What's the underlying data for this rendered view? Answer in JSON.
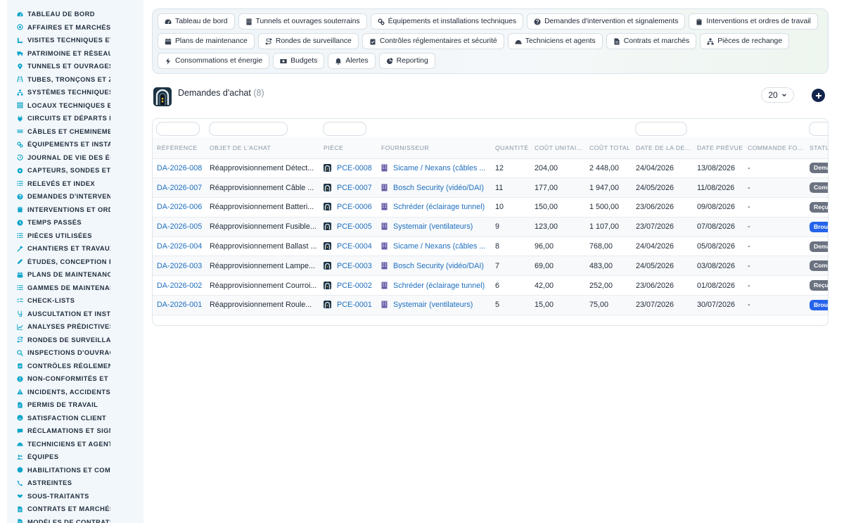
{
  "sidebar": {
    "items": [
      {
        "label": "TABLEAU DE BORD",
        "icon": "gauge-icon"
      },
      {
        "label": "AFFAIRES ET MARCHÉS",
        "icon": "target-icon"
      },
      {
        "label": "VISITES TECHNIQUES ET",
        "icon": "ruler-icon"
      },
      {
        "label": "PATRIMOINE ET RÉSEAUX",
        "icon": "truck-icon"
      },
      {
        "label": "TUNNELS ET OUVRAGES",
        "icon": "map-pin-icon"
      },
      {
        "label": "TUBES, TRONÇONS ET ZO",
        "icon": "road-icon"
      },
      {
        "label": "SYSTÈMES TECHNIQUES",
        "icon": "sitemap-icon"
      },
      {
        "label": "LOCAUX TECHNIQUES ET",
        "icon": "grid-icon"
      },
      {
        "label": "CIRCUITS ET DÉPARTS ÉL",
        "icon": "plug-icon"
      },
      {
        "label": "CÂBLES ET CHEMINEMENT",
        "icon": "cable-icon"
      },
      {
        "label": "ÉQUIPEMENTS ET INSTAL",
        "icon": "gears-icon"
      },
      {
        "label": "JOURNAL DE VIE DES ÉQ",
        "icon": "history-icon"
      },
      {
        "label": "CAPTEURS, SONDES ET C",
        "icon": "sensor-icon"
      },
      {
        "label": "RELEVÉS ET INDEX",
        "icon": "list-icon"
      },
      {
        "label": "DEMANDES D'INTERVENT",
        "icon": "question-icon"
      },
      {
        "label": "INTERVENTIONS ET ORDI",
        "icon": "clipboard-icon"
      },
      {
        "label": "TEMPS PASSÉS",
        "icon": "clock-icon"
      },
      {
        "label": "PIÈCES UTILISÉES",
        "icon": "list-icon"
      },
      {
        "label": "CHANTIERS ET TRAVAUX",
        "icon": "hammer-icon"
      },
      {
        "label": "ÉTUDES, CONCEPTION ET",
        "icon": "pen-ruler-icon"
      },
      {
        "label": "PLANS DE MAINTENANCE",
        "icon": "calendar-icon"
      },
      {
        "label": "GAMMES DE MAINTENAN",
        "icon": "list-icon"
      },
      {
        "label": "CHECK-LISTS",
        "icon": "checklist-icon"
      },
      {
        "label": "AUSCULTATION ET INSTR",
        "icon": "stethoscope-icon"
      },
      {
        "label": "ANALYSES PRÉDICTIVES",
        "icon": "chart-icon"
      },
      {
        "label": "RONDES DE SURVEILLAN",
        "icon": "route-icon"
      },
      {
        "label": "INSPECTIONS D'OUVRAG",
        "icon": "search-icon"
      },
      {
        "label": "CONTRÔLES RÉGLEMENT",
        "icon": "clipboard-check-icon"
      },
      {
        "label": "NON-CONFORMITÉS ET A",
        "icon": "alert-circle-icon"
      },
      {
        "label": "INCIDENTS, ACCIDENTS E",
        "icon": "warning-icon"
      },
      {
        "label": "PERMIS DE TRAVAIL",
        "icon": "file-pen-icon"
      },
      {
        "label": "SATISFACTION CLIENT",
        "icon": "smile-icon"
      },
      {
        "label": "RÉCLAMATIONS ET SIGNA",
        "icon": "comment-icon"
      },
      {
        "label": "TECHNICIENS ET AGENTS",
        "icon": "helmet-icon"
      },
      {
        "label": "ÉQUIPES",
        "icon": "users-icon"
      },
      {
        "label": "HABILITATIONS ET COMP",
        "icon": "certificate-icon"
      },
      {
        "label": "ASTREINTES",
        "icon": "phone-icon"
      },
      {
        "label": "SOUS-TRAITANTS",
        "icon": "handshake-icon"
      },
      {
        "label": "CONTRATS ET MARCHÉS",
        "icon": "file-icon"
      },
      {
        "label": "MODÈLES DE CONTRATS",
        "icon": "file-icon"
      }
    ]
  },
  "topnav": {
    "chips": [
      {
        "label": "Tableau de bord",
        "icon": "gauge-icon"
      },
      {
        "label": "Tunnels et ouvrages souterrains",
        "icon": "building-icon"
      },
      {
        "label": "Équipements et installations techniques",
        "icon": "gears-icon"
      },
      {
        "label": "Demandes d'intervention et signalements",
        "icon": "question-icon"
      },
      {
        "label": "Interventions et ordres de travail",
        "icon": "clipboard-icon"
      },
      {
        "label": "Plans de maintenance",
        "icon": "calendar-icon"
      },
      {
        "label": "Rondes de surveillance",
        "icon": "route-icon"
      },
      {
        "label": "Contrôles réglementaires et sécurité",
        "icon": "clipboard-check-icon"
      },
      {
        "label": "Techniciens et agents",
        "icon": "helmet-icon"
      },
      {
        "label": "Contrats et marchés",
        "icon": "file-icon"
      },
      {
        "label": "Pièces de rechange",
        "icon": "sitemap-icon"
      },
      {
        "label": "Consommations et énergie",
        "icon": "bolt-icon"
      },
      {
        "label": "Budgets",
        "icon": "money-icon"
      },
      {
        "label": "Alertes",
        "icon": "bell-icon"
      },
      {
        "label": "Reporting",
        "icon": "pie-icon"
      }
    ]
  },
  "page": {
    "title": "Demandes d'achat",
    "count": "(8)",
    "per_page": "20"
  },
  "table": {
    "columns": [
      "RÉFÉRENCE",
      "OBJET DE L'ACHAT",
      "PIÈCE",
      "FOURNISSEUR",
      "QUANTITÉ",
      "COÛT UNITAIRE",
      "COÛT TOTAL",
      "DATE DE LA DE...",
      "DATE PRÉVUE",
      "COMMANDE FO...",
      "STATUT"
    ],
    "rows": [
      {
        "ref": "DA-2026-008",
        "objet": "Réapprovisionnement Détect...",
        "piece": "PCE-0008",
        "fournisseur": "Sicame / Nexans (câbles ...",
        "qte": "12",
        "cu": "204,00",
        "ct": "2 448,00",
        "date_dem": "24/04/2026",
        "date_prev": "13/08/2026",
        "commande": "-",
        "statut": "Demande",
        "statut_color": "#6b7280"
      },
      {
        "ref": "DA-2026-007",
        "objet": "Réapprovisionnement Câble ...",
        "piece": "PCE-0007",
        "fournisseur": "Bosch Security (vidéo/DAI)",
        "qte": "11",
        "cu": "177,00",
        "ct": "1 947,00",
        "date_dem": "24/05/2026",
        "date_prev": "11/08/2026",
        "commande": "-",
        "statut": "Commandée",
        "statut_color": "#6b7280"
      },
      {
        "ref": "DA-2026-006",
        "objet": "Réapprovisionnement Batteri...",
        "piece": "PCE-0006",
        "fournisseur": "Schréder (éclairage tunnel)",
        "qte": "10",
        "cu": "150,00",
        "ct": "1 500,00",
        "date_dem": "23/06/2026",
        "date_prev": "09/08/2026",
        "commande": "-",
        "statut": "Reçue",
        "statut_color": "#6b7280"
      },
      {
        "ref": "DA-2026-005",
        "objet": "Réapprovisionnement Fusible...",
        "piece": "PCE-0005",
        "fournisseur": "Systemair (ventilateurs)",
        "qte": "9",
        "cu": "123,00",
        "ct": "1 107,00",
        "date_dem": "23/07/2026",
        "date_prev": "07/08/2026",
        "commande": "-",
        "statut": "Brouillon",
        "statut_color": "#2563eb"
      },
      {
        "ref": "DA-2026-004",
        "objet": "Réapprovisionnement Ballast ...",
        "piece": "PCE-0004",
        "fournisseur": "Sicame / Nexans (câbles ...",
        "qte": "8",
        "cu": "96,00",
        "ct": "768,00",
        "date_dem": "24/04/2026",
        "date_prev": "05/08/2026",
        "commande": "-",
        "statut": "Demande",
        "statut_color": "#6b7280"
      },
      {
        "ref": "DA-2026-003",
        "objet": "Réapprovisionnement Lampe...",
        "piece": "PCE-0003",
        "fournisseur": "Bosch Security (vidéo/DAI)",
        "qte": "7",
        "cu": "69,00",
        "ct": "483,00",
        "date_dem": "24/05/2026",
        "date_prev": "03/08/2026",
        "commande": "-",
        "statut": "Commandée",
        "statut_color": "#6b7280"
      },
      {
        "ref": "DA-2026-002",
        "objet": "Réapprovisionnement Courroi...",
        "piece": "PCE-0002",
        "fournisseur": "Schréder (éclairage tunnel)",
        "qte": "6",
        "cu": "42,00",
        "ct": "252,00",
        "date_dem": "23/06/2026",
        "date_prev": "01/08/2026",
        "commande": "-",
        "statut": "Reçue",
        "statut_color": "#6b7280"
      },
      {
        "ref": "DA-2026-001",
        "objet": "Réapprovisionnement Roule...",
        "piece": "PCE-0001",
        "fournisseur": "Systemair (ventilateurs)",
        "qte": "5",
        "cu": "15,00",
        "ct": "75,00",
        "date_dem": "23/07/2026",
        "date_prev": "30/07/2026",
        "commande": "-",
        "statut": "Brouillon",
        "statut_color": "#2563eb"
      }
    ]
  },
  "colors": {
    "accent": "#0ea5c9",
    "link": "#1f6fbf",
    "numeric": "#0e7a8c",
    "add_button": "#13254d"
  }
}
